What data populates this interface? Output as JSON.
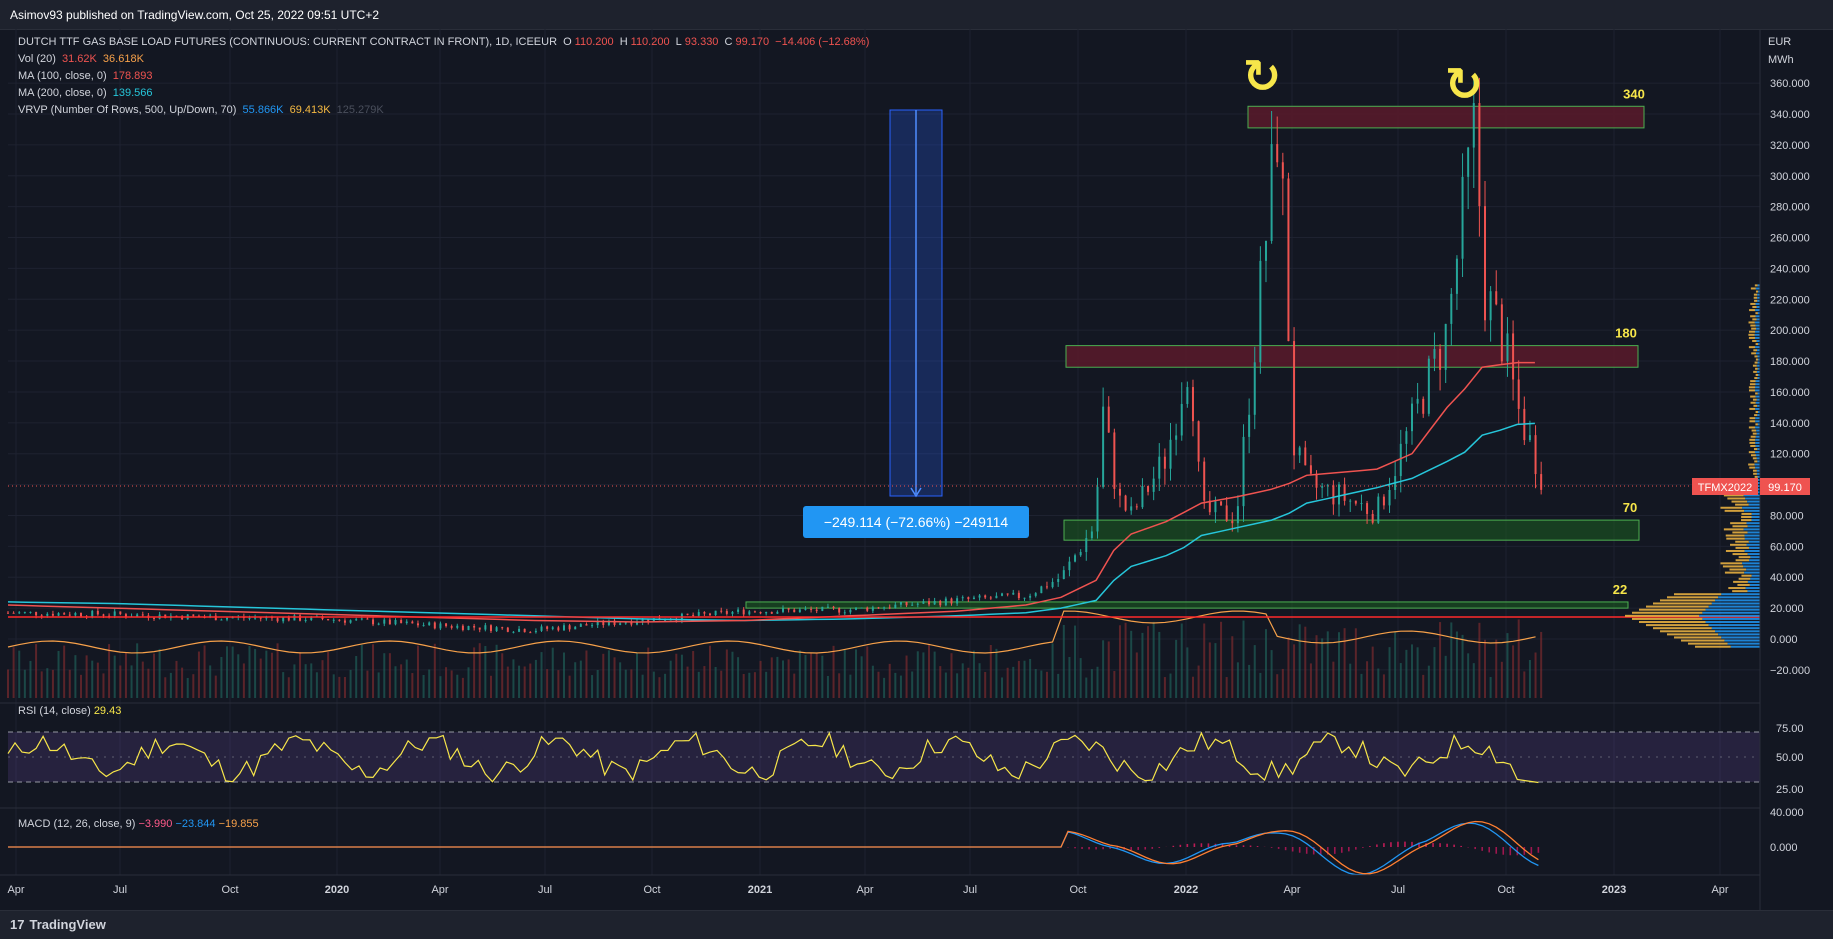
{
  "header": {
    "published": "Asimov93 published on TradingView.com, Oct 25, 2022 09:51 UTC+2"
  },
  "legend": {
    "symbol": "DUTCH TTF GAS BASE LOAD FUTURES (CONTINUOUS: CURRENT CONTRACT IN FRONT), 1D, ICEEUR",
    "o_label": "O",
    "o": "110.200",
    "h_label": "H",
    "h": "110.200",
    "l_label": "L",
    "l": "93.330",
    "c_label": "C",
    "c": "99.170",
    "change": "−14.406 (−12.68%)",
    "vol_label": "Vol (20)",
    "vol_1": "31.62K",
    "vol_2": "36.618K",
    "ma100_label": "MA (100, close, 0)",
    "ma100": "178.893",
    "ma200_label": "MA (200, close, 0)",
    "ma200": "139.566",
    "vrvp_label": "VRVP (Number Of Rows, 500, Up/Down, 70)",
    "vrvp_1": "55.866K",
    "vrvp_2": "69.413K",
    "vrvp_3": "125.279K"
  },
  "rsi": {
    "label": "RSI (14, close)",
    "value": "29.43"
  },
  "macd": {
    "label": "MACD (12, 26, close, 9)",
    "v1": "−3.990",
    "v2": "−23.844",
    "v3": "−19.855"
  },
  "axis": {
    "currency": "EUR",
    "unit": "MWh",
    "price_ticks": [
      "360.000",
      "340.000",
      "320.000",
      "300.000",
      "280.000",
      "260.000",
      "240.000",
      "220.000",
      "200.000",
      "180.000",
      "160.000",
      "140.000",
      "120.000",
      "100.000",
      "80.000",
      "60.000",
      "40.000",
      "20.000",
      "0.000",
      "−20.000"
    ],
    "rsi_ticks": [
      "75.00",
      "50.00",
      "25.00"
    ],
    "macd_ticks": [
      "40.000",
      "0.000"
    ],
    "time_ticks": [
      "Apr",
      "Jul",
      "Oct",
      "2020",
      "Apr",
      "Jul",
      "Oct",
      "2021",
      "Apr",
      "Jul",
      "Oct",
      "2022",
      "Apr",
      "Jul",
      "Oct",
      "2023",
      "Apr"
    ]
  },
  "price_tag": {
    "symbol": "TFMX2022",
    "value": "99.170"
  },
  "annotations": {
    "level_340": "340",
    "level_180": "180",
    "level_70": "70",
    "level_22": "22",
    "measure": "−249.114 (−72.66%) −249114",
    "arrow_1": "↻",
    "arrow_2": "↻"
  },
  "footer": {
    "brand": "TradingView",
    "logo": "17"
  },
  "colors": {
    "background": "#131722",
    "up": "#26a69a",
    "down": "#ef5350",
    "ma100": "#ef5350",
    "ma200": "#26c6da",
    "volume_ma": "#f7a14a",
    "rsi_line": "#f7e64a",
    "macd_line": "#2196f3",
    "signal_line": "#ff7f32",
    "zone_fill": "#5a1a2a",
    "zone_border": "#4caf50",
    "annotation_yellow": "#f7e64a"
  },
  "chart_data": {
    "type": "line",
    "title": "DUTCH TTF GAS BASE LOAD FUTURES (CONTINUOUS: CURRENT CONTRACT IN FRONT), 1D, ICEEUR",
    "ylabel": "EUR / MWh",
    "ylim": [
      -30,
      375
    ],
    "x_dates": [
      "2019-03",
      "2019-06",
      "2019-09",
      "2019-12",
      "2020-03",
      "2020-06",
      "2020-09",
      "2020-12",
      "2021-03",
      "2021-06",
      "2021-08",
      "2021-09",
      "2021-10",
      "2021-10-05",
      "2021-10-20",
      "2021-11",
      "2021-12",
      "2021-12-21",
      "2022-01",
      "2022-02",
      "2022-03-07",
      "2022-03-20",
      "2022-04",
      "2022-05",
      "2022-06",
      "2022-07",
      "2022-08",
      "2022-08-26",
      "2022-09",
      "2022-09-20",
      "2022-10",
      "2022-10-25"
    ],
    "series": [
      {
        "name": "close",
        "values": [
          17,
          16,
          14,
          13,
          9,
          6,
          12,
          18,
          19,
          25,
          28,
          40,
          75,
          155,
          90,
          80,
          118,
          185,
          82,
          80,
          340,
          125,
          100,
          92,
          82,
          140,
          200,
          340,
          230,
          190,
          150,
          99
        ]
      },
      {
        "name": "MA 100",
        "values": [
          22,
          20,
          18,
          16,
          14,
          12,
          11,
          12,
          15,
          18,
          22,
          27,
          38,
          50,
          60,
          68,
          76,
          84,
          88,
          92,
          98,
          102,
          106,
          108,
          110,
          120,
          150,
          170,
          176,
          178,
          179,
          179
        ]
      },
      {
        "name": "MA 200",
        "values": [
          24,
          23,
          21,
          19,
          17,
          15,
          13,
          12,
          13,
          15,
          17,
          20,
          25,
          32,
          40,
          47,
          54,
          61,
          67,
          72,
          78,
          83,
          88,
          93,
          98,
          104,
          115,
          125,
          132,
          136,
          139,
          140
        ]
      }
    ],
    "zones": [
      {
        "label": "340",
        "top": 345,
        "bottom": 331
      },
      {
        "label": "180",
        "top": 190,
        "bottom": 176
      },
      {
        "label": "70",
        "top": 77,
        "bottom": 64
      },
      {
        "label": "22",
        "top": 24,
        "bottom": 20
      }
    ],
    "rsi": {
      "label": "RSI (14, close)",
      "last": 29.43,
      "bands": [
        70,
        30
      ]
    },
    "macd": {
      "label": "MACD (12, 26, close, 9)",
      "hist": -3.99,
      "macd": -23.844,
      "signal": -19.855
    }
  }
}
